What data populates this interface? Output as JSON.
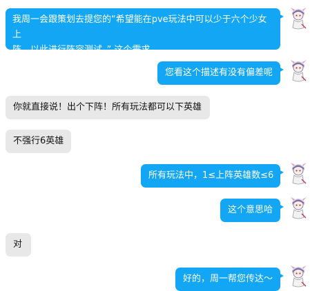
{
  "colors": {
    "outgoing_bubble": "#12a6f5",
    "incoming_bubble": "#e8e8e8",
    "background": "#ffffff"
  },
  "messages": [
    {
      "side": "outgoing",
      "lines": [
        "我周一会跟策划去提您的“希望能在pve玩法中可以少于六个少女上",
        "阵，以此进行阵容测试。” 这个需求"
      ]
    },
    {
      "side": "outgoing",
      "text": "您看这个描述有没有偏差呢"
    },
    {
      "side": "incoming",
      "text": "你就直接说！出个下阵！所有玩法都可以下英雄"
    },
    {
      "side": "incoming",
      "text": "不强行6英雄"
    },
    {
      "side": "outgoing",
      "text": "所有玩法中，1≤上阵英雄数≤6"
    },
    {
      "side": "outgoing",
      "text": "这个意思哈"
    },
    {
      "side": "incoming",
      "text": "对"
    },
    {
      "side": "outgoing",
      "text": "好的，周一帮您传达～"
    }
  ],
  "avatar_icon": "anime-girl-avatar-icon"
}
